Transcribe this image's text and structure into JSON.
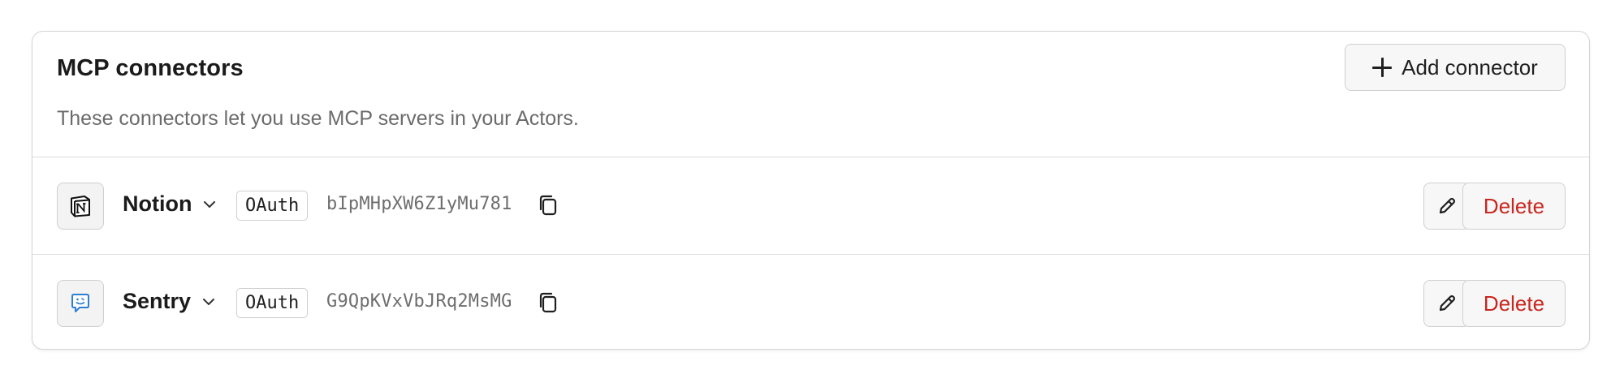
{
  "card": {
    "title": "MCP connectors",
    "description": "These connectors let you use MCP servers in your Actors.",
    "add_button_label": "Add connector"
  },
  "connectors": [
    {
      "name": "Notion",
      "icon": "notion-logo-icon",
      "auth_type": "OAuth",
      "token": "bIpMHpXW6Z1yMu781",
      "delete_label": "Delete"
    },
    {
      "name": "Sentry",
      "icon": "chat-bubble-smile-icon",
      "auth_type": "OAuth",
      "token": "G9QpKVxVbJRq2MsMG",
      "delete_label": "Delete"
    }
  ],
  "colors": {
    "delete_text": "#c9271f",
    "border": "#d4d4d4",
    "muted_text": "#6b6b6b",
    "sentry_icon": "#2f7fd1"
  }
}
